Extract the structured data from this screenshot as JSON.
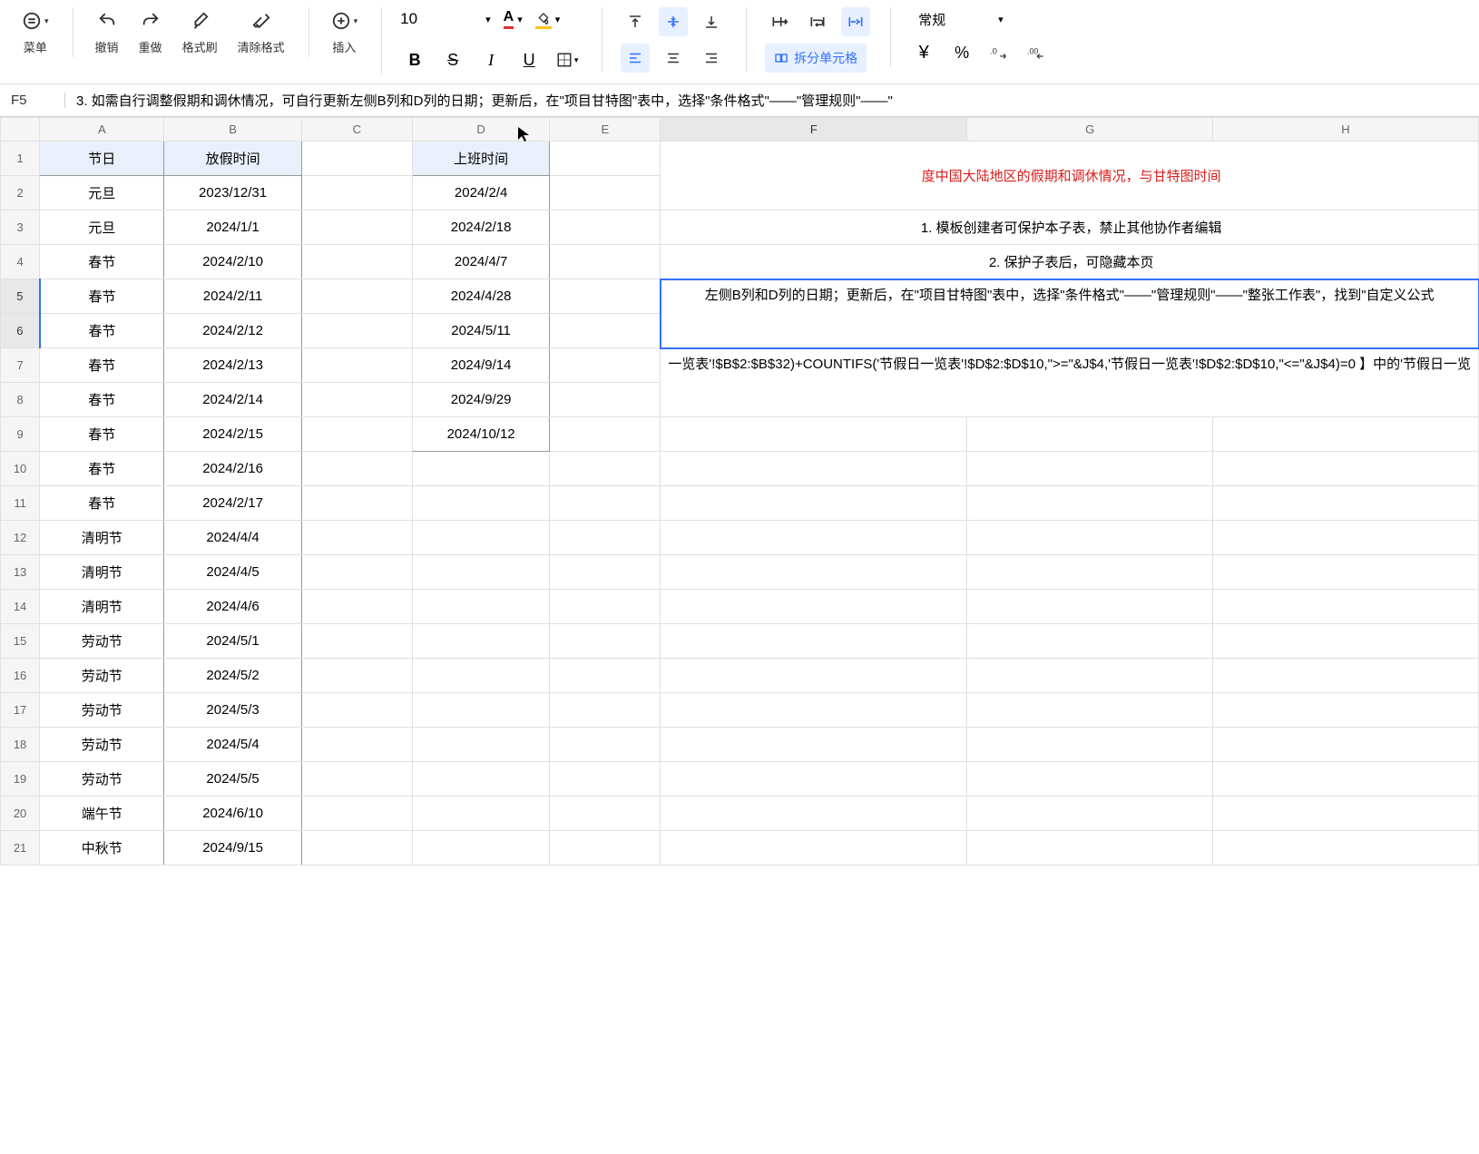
{
  "toolbar": {
    "menu_label": "菜单",
    "undo_label": "撤销",
    "redo_label": "重做",
    "format_painter_label": "格式刷",
    "clear_format_label": "清除格式",
    "insert_label": "插入",
    "font_size": "10",
    "number_format": "常规",
    "split_cells_label": "拆分单元格"
  },
  "formula_bar": {
    "cell_ref": "F5",
    "content": "3. 如需自行调整假期和调休情况，可自行更新左侧B列和D列的日期；更新后，在\"项目甘特图\"表中，选择\"条件格式\"——\"管理规则\"——\""
  },
  "columns": [
    "A",
    "B",
    "C",
    "D",
    "E",
    "F",
    "G",
    "H"
  ],
  "headers": {
    "holiday": "节日",
    "vacation_time": "放假时间",
    "work_time": "上班时间"
  },
  "holidays": [
    {
      "name": "元旦",
      "date": "2023/12/31",
      "work": "2024/2/4"
    },
    {
      "name": "元旦",
      "date": "2024/1/1",
      "work": "2024/2/18"
    },
    {
      "name": "春节",
      "date": "2024/2/10",
      "work": "2024/4/7"
    },
    {
      "name": "春节",
      "date": "2024/2/11",
      "work": "2024/4/28"
    },
    {
      "name": "春节",
      "date": "2024/2/12",
      "work": "2024/5/11"
    },
    {
      "name": "春节",
      "date": "2024/2/13",
      "work": "2024/9/14"
    },
    {
      "name": "春节",
      "date": "2024/2/14",
      "work": "2024/9/29"
    },
    {
      "name": "春节",
      "date": "2024/2/15",
      "work": "2024/10/12"
    },
    {
      "name": "春节",
      "date": "2024/2/16",
      "work": ""
    },
    {
      "name": "春节",
      "date": "2024/2/17",
      "work": ""
    },
    {
      "name": "清明节",
      "date": "2024/4/4",
      "work": ""
    },
    {
      "name": "清明节",
      "date": "2024/4/5",
      "work": ""
    },
    {
      "name": "清明节",
      "date": "2024/4/6",
      "work": ""
    },
    {
      "name": "劳动节",
      "date": "2024/5/1",
      "work": ""
    },
    {
      "name": "劳动节",
      "date": "2024/5/2",
      "work": ""
    },
    {
      "name": "劳动节",
      "date": "2024/5/3",
      "work": ""
    },
    {
      "name": "劳动节",
      "date": "2024/5/4",
      "work": ""
    },
    {
      "name": "劳动节",
      "date": "2024/5/5",
      "work": ""
    },
    {
      "name": "端午节",
      "date": "2024/6/10",
      "work": ""
    },
    {
      "name": "中秋节",
      "date": "2024/9/15",
      "work": ""
    }
  ],
  "notes": {
    "red_title": "度中国大陆地区的假期和调休情况，与甘特图时间",
    "note1": "1. 模板创建者可保护本子表，禁止其他协作者编辑",
    "note2": "2. 保护子表后，可隐藏本页",
    "note3": "左侧B列和D列的日期；更新后，在\"项目甘特图\"表中，选择\"条件格式\"——\"管理规则\"——\"整张工作表\"，找到\"自定义公式",
    "note4": "一览表'!$B$2:$B$32)+COUNTIFS('节假日一览表'!$D$2:$D$10,\">=\"&J$4,'节假日一览表'!$D$2:$D$10,\"<=\"&J$4)=0 】中的'节假日一览"
  }
}
